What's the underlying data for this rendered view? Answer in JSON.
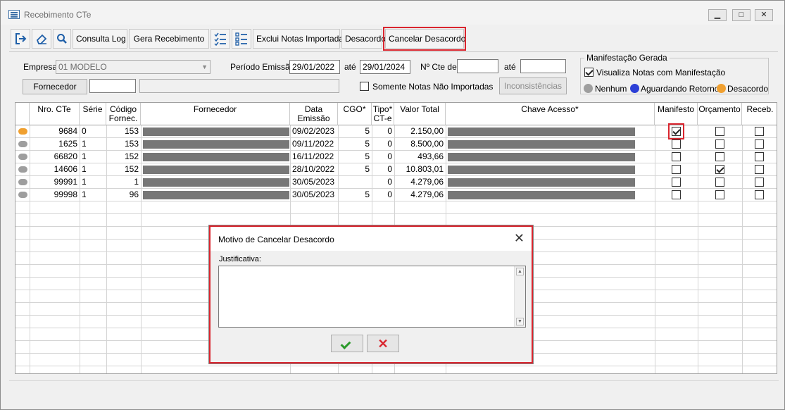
{
  "window": {
    "title": "Recebimento CTe",
    "min": "▁",
    "max": "□",
    "close": "✕"
  },
  "toolbar": {
    "consulta_log": "Consulta Log",
    "gera_recebimento": "Gera Recebimento",
    "exclui_notas": "Exclui Notas Importadas",
    "desacordo": "Desacordo",
    "cancelar_desacordo": "Cancelar Desacordo"
  },
  "filters": {
    "empresa_label": "Empresa",
    "empresa_value": "01 MODELO",
    "periodo_label": "Período Emissão",
    "periodo_de": "29/01/2022",
    "ate_label": "até",
    "periodo_ate": "29/01/2024",
    "nro_cte_label": "Nº Cte de",
    "nro_cte_de": "",
    "ate2_label": "até",
    "nro_cte_ate": "",
    "fornecedor_button": "Fornecedor",
    "fornecedor_code": "",
    "fornecedor_name": "",
    "somente_label": "Somente Notas Não Importadas",
    "inconsistencias_button": "Inconsistências"
  },
  "manifest_group": {
    "title": "Manifestação Gerada",
    "visualiza_label": "Visualiza Notas com Manifestação",
    "legend": [
      {
        "label": "Nenhum",
        "color": "#9e9e9e"
      },
      {
        "label": "Aguardando Retorno",
        "color": "#2c3fd6"
      },
      {
        "label": "Desacordo",
        "color": "#f0a030"
      }
    ]
  },
  "table": {
    "headers": {
      "nro": "Nro. CTe",
      "serie": "Série",
      "codigo": "Código Fornec.",
      "fornecedor": "Fornecedor",
      "data": "Data Emissão",
      "cgo": "CGO*",
      "tipo": "Tipo* CT-e",
      "valor": "Valor Total",
      "chave": "Chave Acesso*",
      "manifesto": "Manifesto",
      "orcamento": "Orçamento",
      "receb": "Receb."
    },
    "rows": [
      {
        "status_color": "#f0a030",
        "nro": "9684",
        "serie": "0",
        "codigo": "153",
        "data": "09/02/2023",
        "cgo": "5",
        "tipo": "0",
        "valor": "2.150,00",
        "manifesto": true,
        "orcamento": false,
        "receb": false
      },
      {
        "status_color": "#9e9e9e",
        "nro": "1625",
        "serie": "1",
        "codigo": "153",
        "data": "09/11/2022",
        "cgo": "5",
        "tipo": "0",
        "valor": "8.500,00",
        "manifesto": false,
        "orcamento": false,
        "receb": false
      },
      {
        "status_color": "#9e9e9e",
        "nro": "66820",
        "serie": "1",
        "codigo": "152",
        "data": "16/11/2022",
        "cgo": "5",
        "tipo": "0",
        "valor": "493,66",
        "manifesto": false,
        "orcamento": false,
        "receb": false
      },
      {
        "status_color": "#9e9e9e",
        "nro": "14606",
        "serie": "1",
        "codigo": "152",
        "data": "28/10/2022",
        "cgo": "5",
        "tipo": "0",
        "valor": "10.803,01",
        "manifesto": false,
        "orcamento": true,
        "receb": false
      },
      {
        "status_color": "#9e9e9e",
        "nro": "99991",
        "serie": "1",
        "codigo": "1",
        "data": "30/05/2023",
        "cgo": "",
        "tipo": "0",
        "valor": "4.279,06",
        "manifesto": false,
        "orcamento": false,
        "receb": false
      },
      {
        "status_color": "#9e9e9e",
        "nro": "99998",
        "serie": "1",
        "codigo": "96",
        "data": "30/05/2023",
        "cgo": "5",
        "tipo": "0",
        "valor": "4.279,06",
        "manifesto": false,
        "orcamento": false,
        "receb": false
      }
    ]
  },
  "dialog": {
    "title": "Motivo de Cancelar Desacordo",
    "close": "✕",
    "justificativa_label": "Justificativa:",
    "justificativa_value": "",
    "cancel_glyph": "✕"
  }
}
